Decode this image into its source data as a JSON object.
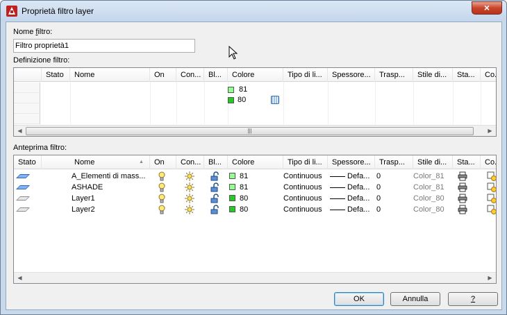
{
  "window": {
    "title": "Proprietà filtro layer",
    "close_label": "×"
  },
  "filter_name": {
    "label_pre": "Nome ",
    "label_u": "f",
    "label_post": "iltro:",
    "value": "Filtro proprietà1"
  },
  "definition": {
    "label": "Definizione filtro:",
    "headers": [
      "Stato",
      "Nome",
      "On",
      "Con...",
      "Bl...",
      "Colore",
      "Tipo di li...",
      "Spessore...",
      "Trasp...",
      "Stile di...",
      "Sta...",
      "Co..."
    ],
    "color_values": [
      "81",
      "80"
    ]
  },
  "preview": {
    "label": "Anteprima filtro:",
    "headers": [
      "Stato",
      "Nome",
      "On",
      "Con...",
      "Bl...",
      "Colore",
      "Tipo di li...",
      "Spessore...",
      "Trasp...",
      "Stile di...",
      "Sta...",
      "Co..."
    ],
    "rows": [
      {
        "name": "A_Elementi di mass...",
        "color": "81",
        "linetype": "Continuous",
        "lineweight": "Defa...",
        "transparency": "0",
        "plotstyle": "Color_81",
        "active": true
      },
      {
        "name": "ASHADE",
        "color": "81",
        "linetype": "Continuous",
        "lineweight": "Defa...",
        "transparency": "0",
        "plotstyle": "Color_81",
        "active": true
      },
      {
        "name": "Layer1",
        "color": "80",
        "linetype": "Continuous",
        "lineweight": "Defa...",
        "transparency": "0",
        "plotstyle": "Color_80",
        "active": false
      },
      {
        "name": "Layer2",
        "color": "80",
        "linetype": "Continuous",
        "lineweight": "Defa...",
        "transparency": "0",
        "plotstyle": "Color_80",
        "active": false
      }
    ]
  },
  "buttons": {
    "ok": "OK",
    "cancel": "Annulla",
    "help": "?"
  },
  "scroll": {
    "thumb_grip": "|||",
    "left": "◀",
    "right": "▶"
  }
}
